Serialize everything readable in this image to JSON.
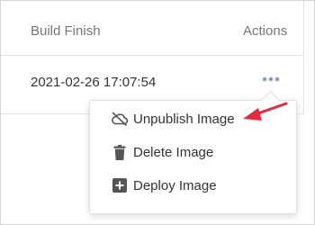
{
  "table": {
    "columns": {
      "build_finish": "Build Finish",
      "actions": "Actions"
    },
    "rows": [
      {
        "build_finish": "2021-02-26 17:07:54"
      }
    ]
  },
  "menu": {
    "items": [
      {
        "label": "Unpublish Image",
        "icon": "cloud-off-icon"
      },
      {
        "label": "Delete Image",
        "icon": "trash-icon"
      },
      {
        "label": "Deploy Image",
        "icon": "plus-square-icon"
      }
    ]
  },
  "colors": {
    "annotation_arrow": "#e8283c",
    "kebab": "#8a9cc7",
    "icon": "#555555"
  }
}
